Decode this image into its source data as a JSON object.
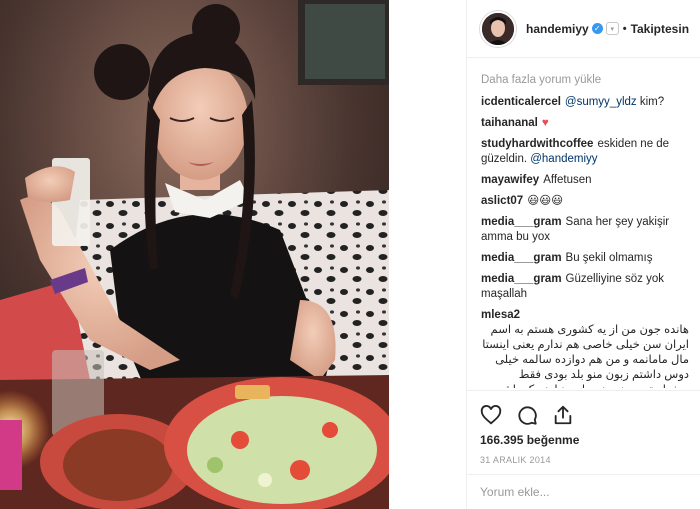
{
  "post": {
    "image_alt": "Photo of a young woman with hair buns seated at a dinner table holding a glass",
    "header": {
      "username": "handemiyy",
      "verified": true,
      "separator": "•",
      "follow_label": "Takiptesin"
    },
    "load_more": "Daha fazla yorum yükle",
    "comments": [
      {
        "user": "icdenticalercel",
        "text": "",
        "mention": "@sumyy_yldz",
        "after": " kim?"
      },
      {
        "user": "taihananal",
        "text": "",
        "heart": "♥"
      },
      {
        "user": "studyhardwithcoffee",
        "text": "eskiden ne de güzeldin. ",
        "mention": "@handemiyy"
      },
      {
        "user": "mayawifey",
        "text": "Affetusen"
      },
      {
        "user": "aslict07",
        "text": "😃😃😃"
      },
      {
        "user": "media___gram",
        "text": "Sana her şey yakişir amma bu yox"
      },
      {
        "user": "media___gram",
        "text": "Bu şekil olmamış"
      },
      {
        "user": "media___gram",
        "text": "Güzelliyine söz yok maşallah"
      },
      {
        "user": "mlesa2",
        "text": "هانده جون من از یه کشوری هستم به اسم ایران سن خیلی خاصی هم ندارم یعنی اینستا مال مامانمه و من هم دوازده سالمه خیلی دوس داشتم زبون منو بلد بودی فقط میخواستم بدونی هر جای دنیا هم که باشی حتی اگه زبونم رو بلد نباشی"
      }
    ],
    "likes": "166.395 beğenme",
    "date": "31 ARALIK 2014",
    "comment_placeholder": "Yorum ekle...",
    "icons": [
      "heart-outline-icon",
      "comment-bubble-icon",
      "share-upload-icon"
    ],
    "colors": {
      "link": "#003569",
      "muted": "#999999",
      "verified": "#3897f0",
      "heart": "#ed4956"
    }
  }
}
